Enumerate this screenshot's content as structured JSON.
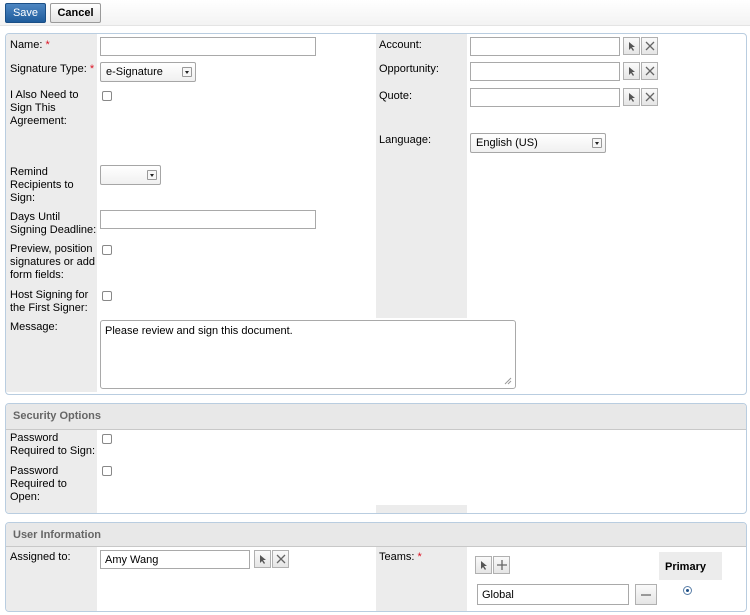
{
  "toolbar": {
    "save_label": "Save",
    "cancel_label": "Cancel"
  },
  "main": {
    "name_label": "Name:",
    "name_value": "",
    "signature_type_label": "Signature Type:",
    "signature_type_value": "e-Signature",
    "also_sign_label_1": "I Also Need to",
    "also_sign_label_2": "Sign This",
    "also_sign_label_3": "Agreement:",
    "account_label": "Account:",
    "account_value": "",
    "opportunity_label": "Opportunity:",
    "opportunity_value": "",
    "quote_label": "Quote:",
    "quote_value": "",
    "language_label": "Language:",
    "language_value": "English (US)",
    "remind_label_1": "Remind",
    "remind_label_2": "Recipients to",
    "remind_label_3": "Sign:",
    "remind_value": "",
    "days_label_1": "Days Until",
    "days_label_2": "Signing Deadline:",
    "days_value": "",
    "preview_label_1": "Preview, position",
    "preview_label_2": "signatures or add",
    "preview_label_3": "form fields:",
    "host_label_1": "Host Signing for",
    "host_label_2": "the First Signer:",
    "message_label": "Message:",
    "message_value": "Please review and sign this document."
  },
  "security": {
    "title": "Security Options",
    "pw_sign_label_1": "Password",
    "pw_sign_label_2": "Required to Sign:",
    "pw_open_label_1": "Password",
    "pw_open_label_2": "Required to",
    "pw_open_label_3": "Open:"
  },
  "user_info": {
    "title": "User Information",
    "assigned_label": "Assigned to:",
    "assigned_value": "Amy Wang",
    "teams_label": "Teams:",
    "primary_label": "Primary",
    "team_value": "Global"
  },
  "icons": {
    "select": "cursor-arrow-icon",
    "clear": "close-x-icon",
    "add": "plus-icon",
    "remove": "minus-icon"
  },
  "colors": {
    "save_button": "#2a68a8",
    "required_star": "#dd1122",
    "label_bg": "#ececec",
    "panel_border": "#b9cde0"
  }
}
